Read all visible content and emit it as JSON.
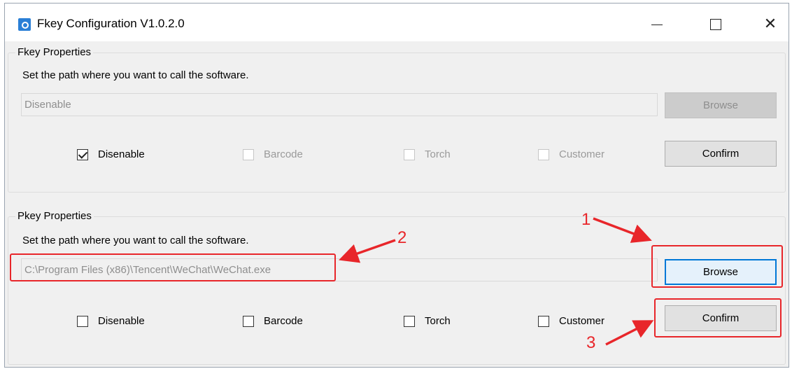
{
  "window": {
    "title": "Fkey Configuration V1.0.2.0"
  },
  "fkey": {
    "group_title": "Fkey Properties",
    "hint": "Set the path where you want to call the software.",
    "path_value": "Disenable",
    "browse_label": "Browse",
    "confirm_label": "Confirm",
    "options": [
      {
        "label": "Disenable",
        "checked": true,
        "enabled": true
      },
      {
        "label": "Barcode",
        "checked": false,
        "enabled": false
      },
      {
        "label": "Torch",
        "checked": false,
        "enabled": false
      },
      {
        "label": "Customer",
        "checked": false,
        "enabled": false
      }
    ]
  },
  "pkey": {
    "group_title": "Pkey Properties",
    "hint": "Set the path where you want to call the software.",
    "path_value": "C:\\Program Files (x86)\\Tencent\\WeChat\\WeChat.exe",
    "browse_label": "Browse",
    "confirm_label": "Confirm",
    "options": [
      {
        "label": "Disenable",
        "checked": false,
        "enabled": true
      },
      {
        "label": "Barcode",
        "checked": false,
        "enabled": true
      },
      {
        "label": "Torch",
        "checked": false,
        "enabled": true
      },
      {
        "label": "Customer",
        "checked": false,
        "enabled": true
      }
    ]
  },
  "annotations": {
    "step1": "1",
    "step2": "2",
    "step3": "3",
    "color": "#e8262a"
  }
}
